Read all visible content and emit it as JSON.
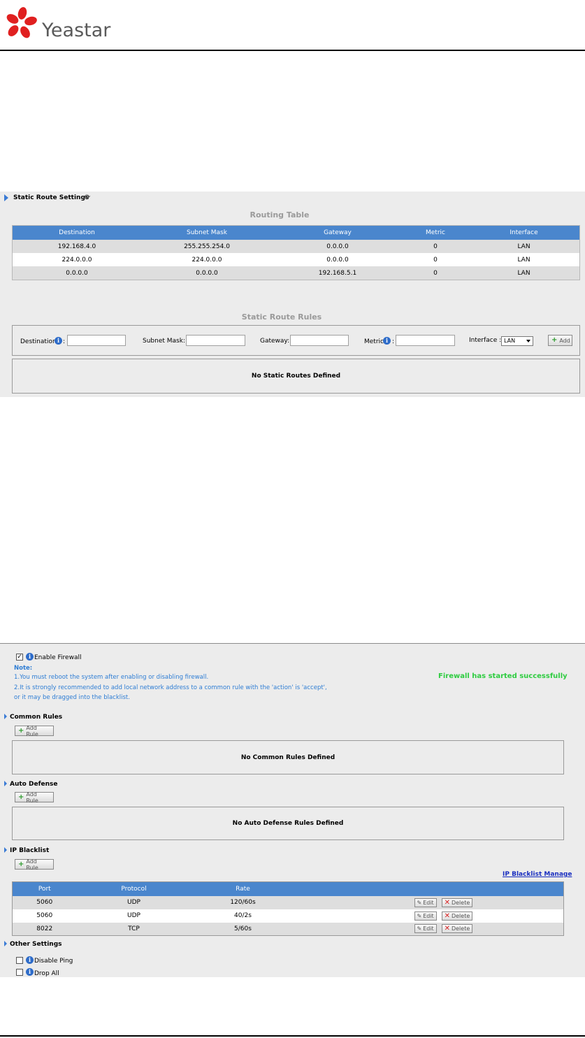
{
  "header": {
    "brand": "Yeastar"
  },
  "static_route": {
    "section_title": "Static Route Settings",
    "refresh_icon": "refresh-icon",
    "routing_table": {
      "heading": "Routing Table",
      "columns": [
        "Destination",
        "Subnet Mask",
        "Gateway",
        "Metric",
        "Interface"
      ],
      "rows": [
        [
          "192.168.4.0",
          "255.255.254.0",
          "0.0.0.0",
          "0",
          "LAN"
        ],
        [
          "224.0.0.0",
          "224.0.0.0",
          "0.0.0.0",
          "0",
          "LAN"
        ],
        [
          "0.0.0.0",
          "0.0.0.0",
          "192.168.5.1",
          "0",
          "LAN"
        ]
      ]
    },
    "rules": {
      "heading": "Static Route Rules",
      "destination_label": "Destination",
      "subnet_label": "Subnet Mask:",
      "gateway_label": "Gateway:",
      "metric_label": "Metric",
      "colon": ":",
      "interface_label": "Interface :",
      "interface_value": "LAN",
      "add_label": "Add",
      "empty": "No Static Routes Defined"
    }
  },
  "firewall": {
    "enable_label": "Enable Firewall",
    "enable_checked": true,
    "note_title": "Note:",
    "note_1": "1.You must reboot the system after enabling or disabling firewall.",
    "note_2": "2.It is strongly recommended to add local network address to a common rule with the 'action' is 'accept',",
    "note_3": "or it may be dragged into the blacklist.",
    "status": "Firewall has started successfully",
    "status_color": "#2ecc40",
    "common_rules": {
      "title": "Common Rules",
      "add_label": "Add Rule",
      "empty": "No Common Rules Defined"
    },
    "auto_defense": {
      "title": "Auto Defense",
      "add_label": "Add Rule",
      "empty": "No Auto Defense Rules Defined"
    },
    "ip_blacklist": {
      "title": "IP Blacklist",
      "add_label": "Add Rule",
      "manage_link": "IP Blacklist Manage",
      "columns": [
        "Port",
        "Protocol",
        "Rate"
      ],
      "rows": [
        [
          "5060",
          "UDP",
          "120/60s"
        ],
        [
          "5060",
          "UDP",
          "40/2s"
        ],
        [
          "8022",
          "TCP",
          "5/60s"
        ]
      ],
      "edit_label": "Edit",
      "delete_label": "Delete"
    },
    "other_settings": {
      "title": "Other Settings",
      "disable_ping_label": "Disable Ping",
      "drop_all_label": "Drop All"
    }
  }
}
